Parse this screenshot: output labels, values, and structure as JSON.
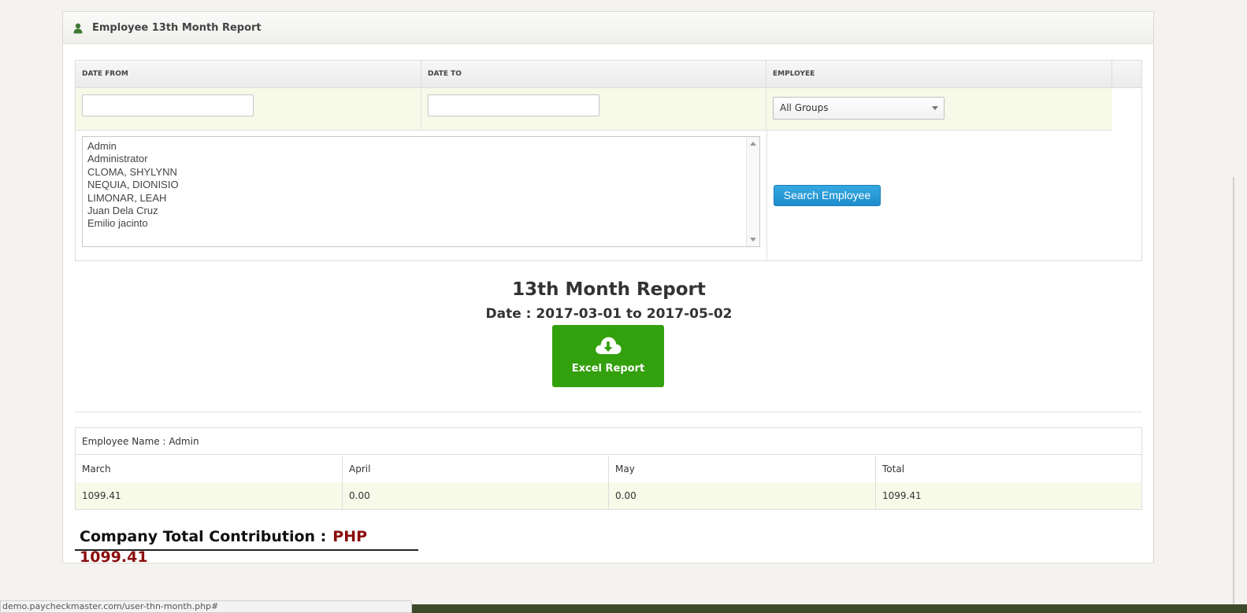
{
  "panel": {
    "title": "Employee 13th Month Report"
  },
  "filters": {
    "headers": [
      "DATE FROM",
      "DATE TO",
      "EMPLOYEE"
    ],
    "date_from_value": "",
    "date_to_value": "",
    "group_select": "All Groups",
    "employees": [
      "Admin",
      "Administrator",
      "CLOMA, SHYLYNN",
      "NEQUIA, DIONISIO",
      "LIMONAR, LEAH",
      "Juan Dela Cruz",
      "Emilio jacinto"
    ],
    "search_button": "Search Employee"
  },
  "report": {
    "title": "13th Month Report",
    "date_line": "Date : 2017-03-01 to 2017-05-02",
    "excel_button": "Excel Report"
  },
  "employee_table": {
    "name_line": "Employee Name : Admin",
    "columns": [
      "March",
      "April",
      "May",
      "Total"
    ],
    "values": [
      "1099.41",
      "0.00",
      "0.00",
      "1099.41"
    ]
  },
  "company_total": {
    "label": "Company Total Contribution :",
    "amount": "PHP 1099.41"
  },
  "status_bar": {
    "url": "demo.paycheckmaster.com/user-thn-month.php#"
  },
  "colors": {
    "accent_blue": "#1d8ccd",
    "excel_green": "#33a00d",
    "amount_red": "#8b0d0d",
    "row_highlight": "#f7f9e9"
  }
}
